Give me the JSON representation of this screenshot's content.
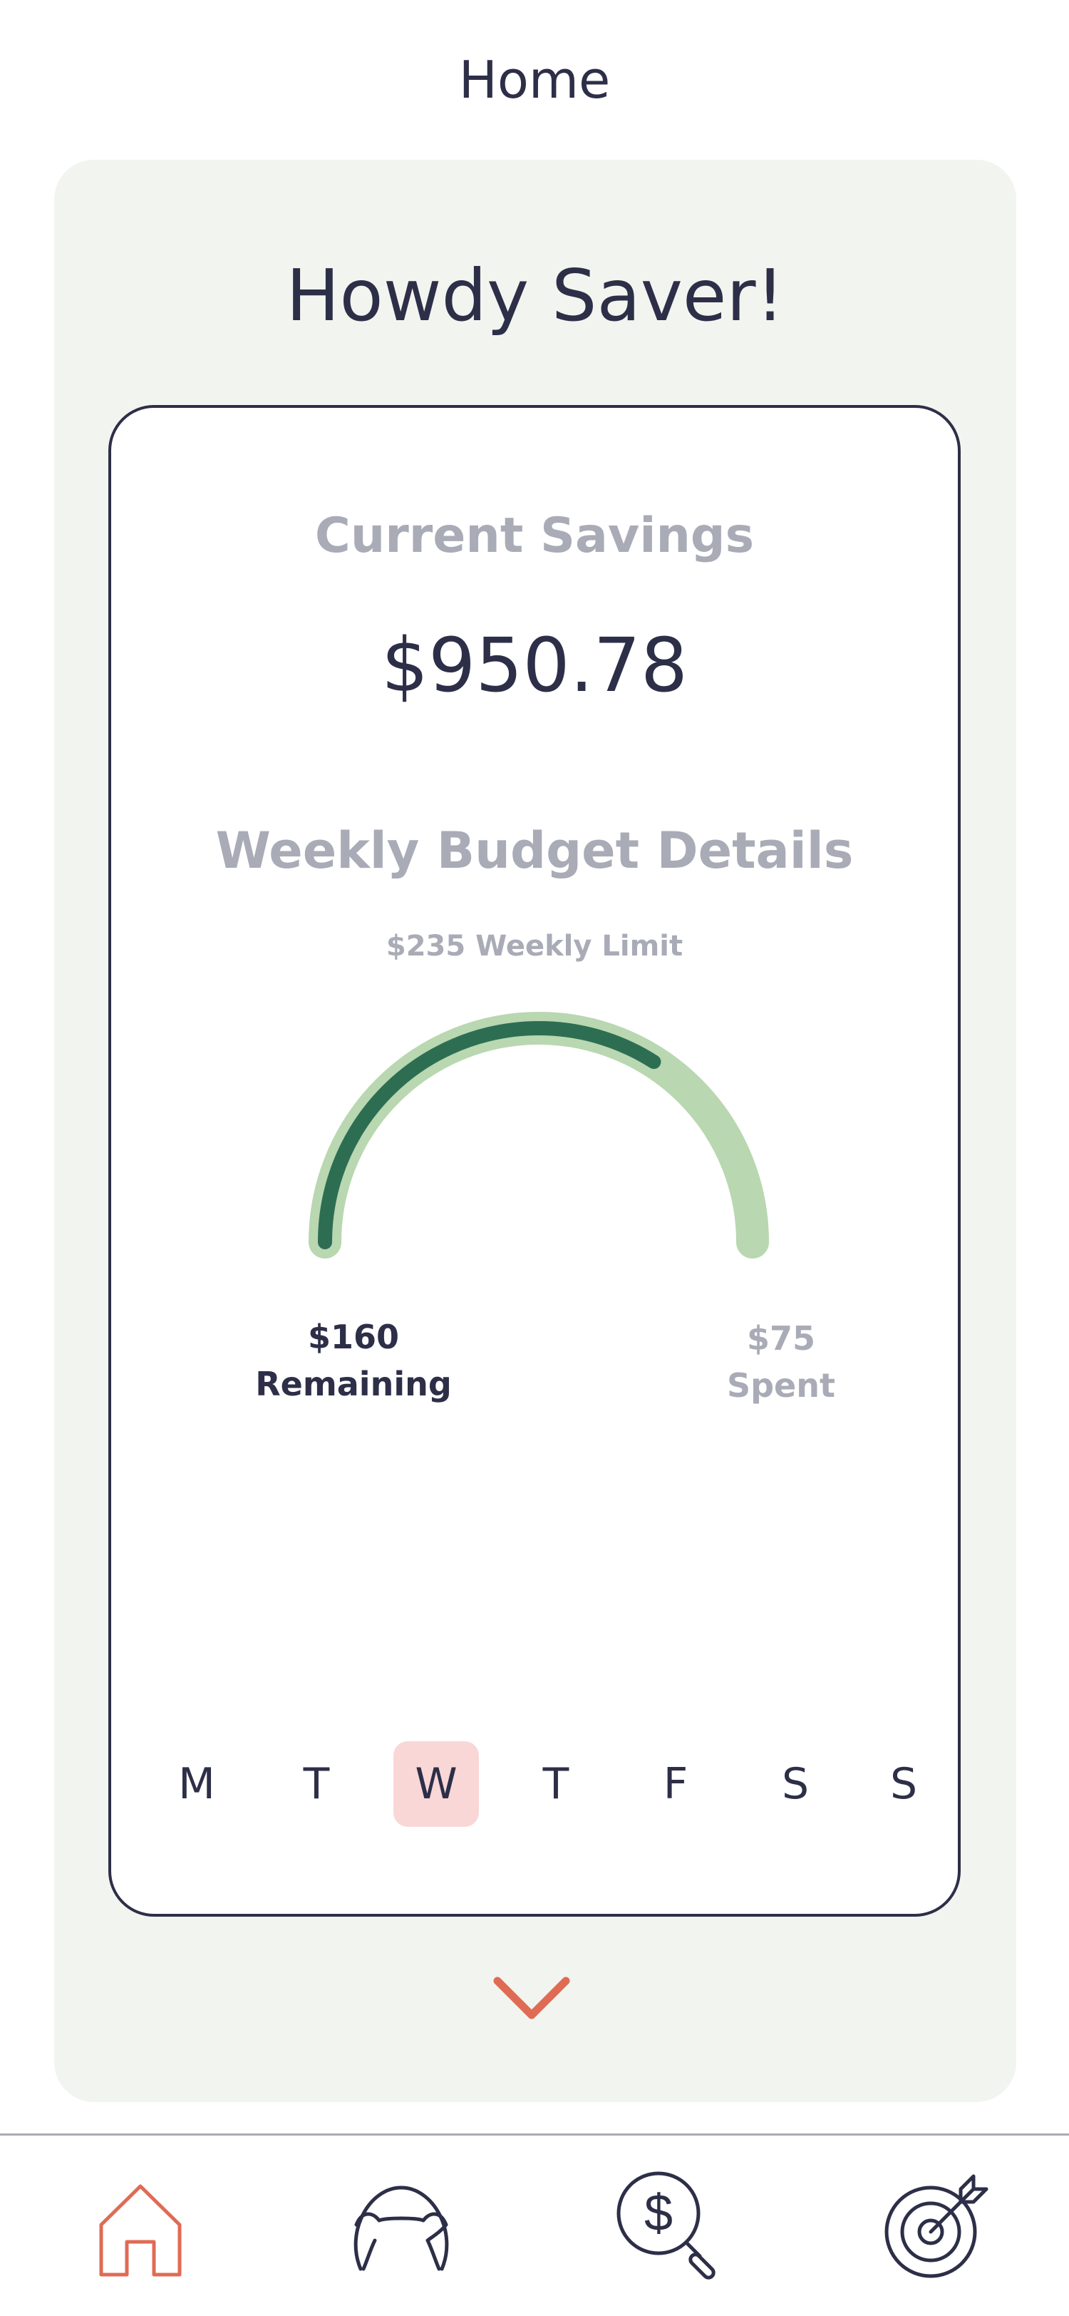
{
  "header": {
    "title": "Home"
  },
  "greeting": "Howdy Saver!",
  "card": {
    "savings_label": "Current Savings",
    "savings_value": "$950.78",
    "budget_label": "Weekly Budget Details",
    "limit_label": "$235 Weekly Limit",
    "gauge": {
      "limit": 235,
      "remaining": 160,
      "spent": 75
    },
    "remaining_value": "$160",
    "remaining_label": "Remaining",
    "spent_value": "$75",
    "spent_label": "Spent",
    "days": [
      {
        "label": "M",
        "selected": false
      },
      {
        "label": "T",
        "selected": false
      },
      {
        "label": "W",
        "selected": true
      },
      {
        "label": "T",
        "selected": false
      },
      {
        "label": "F",
        "selected": false
      },
      {
        "label": "S",
        "selected": false
      },
      {
        "label": "S",
        "selected": false
      }
    ]
  },
  "nav": [
    {
      "icon": "home-icon",
      "active": true
    },
    {
      "icon": "piggy-bank-icon",
      "active": false
    },
    {
      "icon": "dollar-search-icon",
      "active": false
    },
    {
      "icon": "target-icon",
      "active": false
    }
  ],
  "colors": {
    "text": "#2d2f48",
    "muted": "#a9abb6",
    "panel_bg": "#f2f4ef",
    "gauge_track": "#b9d7b0",
    "gauge_fill": "#2d6e53",
    "accent": "#e06b55",
    "day_highlight": "#f9d7d7"
  }
}
